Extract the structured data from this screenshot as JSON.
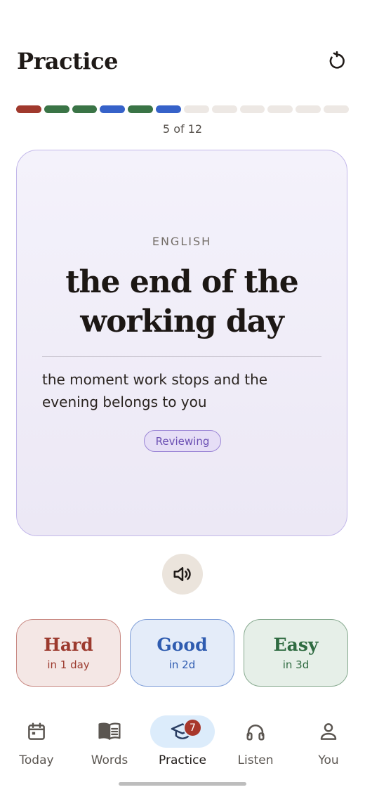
{
  "header": {
    "title": "Practice"
  },
  "progress": {
    "segments": [
      "hard",
      "good",
      "good",
      "easy",
      "good",
      "easy",
      "pending",
      "pending",
      "pending",
      "pending",
      "pending",
      "pending"
    ],
    "colors": {
      "hard": "#a0392d",
      "good": "#3a7446",
      "easy": "#3662c9",
      "pending": "#ede8e4"
    },
    "counter": "5 of 12"
  },
  "card": {
    "language": "ENGLISH",
    "term": "the end of the working day",
    "definition": "the moment work stops and the evening belongs to you",
    "status": "Reviewing"
  },
  "ratings": {
    "hard": {
      "label": "Hard",
      "interval": "in 1 day"
    },
    "good": {
      "label": "Good",
      "interval": "in 2d"
    },
    "easy": {
      "label": "Easy",
      "interval": "in 3d"
    }
  },
  "nav": {
    "today": "Today",
    "words": "Words",
    "practice": "Practice",
    "practice_badge": "7",
    "listen": "Listen",
    "you": "You"
  }
}
